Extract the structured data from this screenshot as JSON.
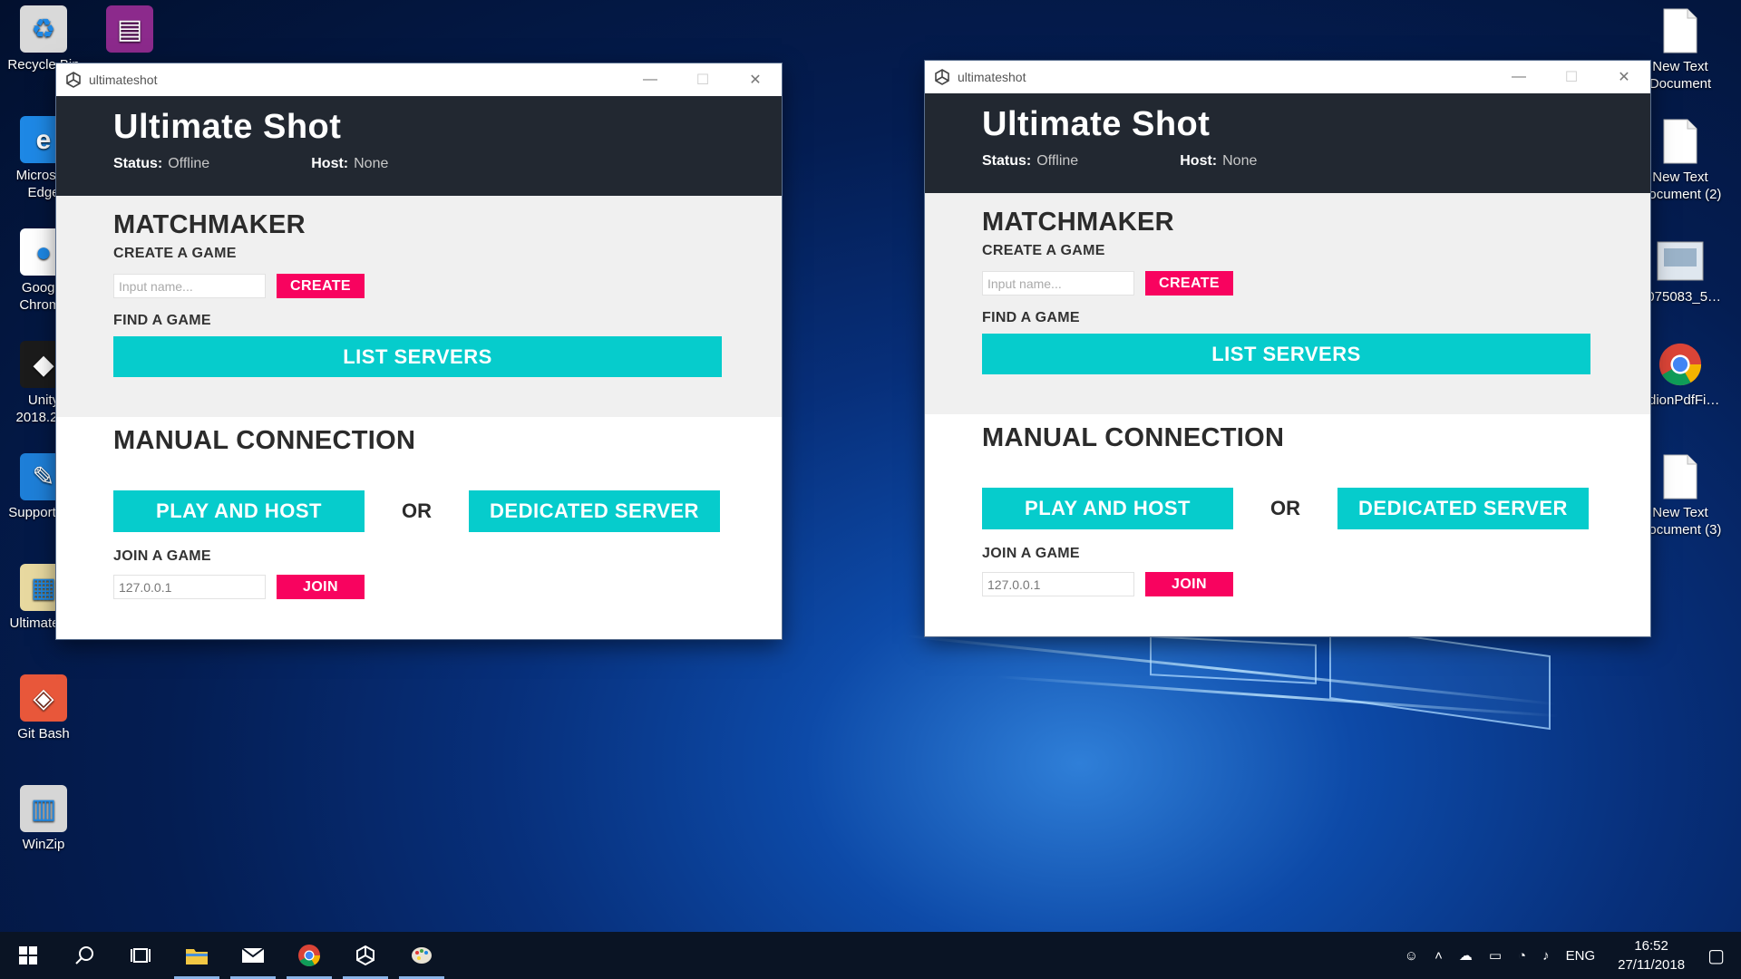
{
  "desktop": {
    "left_icons": [
      {
        "name": "recycle-bin-icon",
        "label": "Recycle Bin",
        "glyph": "♻",
        "bg": "#d9d9d9"
      },
      {
        "name": "winrar-icon",
        "label": "",
        "glyph": "▤",
        "bg": "#8c2a8c"
      },
      {
        "name": "edge-icon",
        "label": "Microsoft Edge",
        "glyph": "e",
        "bg": "#1e88e5"
      },
      {
        "name": "chrome-icon",
        "label": "Google Chrome",
        "glyph": "●",
        "bg": "#ffffff"
      },
      {
        "name": "unity-icon",
        "label": "Unity 2018.2…",
        "glyph": "◆",
        "bg": "#1b1b1b"
      },
      {
        "name": "support-icon",
        "label": "SupportA…",
        "glyph": "✎",
        "bg": "#1e7fd8"
      },
      {
        "name": "folder-icon",
        "label": "Ultimate-…",
        "glyph": "▦",
        "bg": "#e8d9a0"
      },
      {
        "name": "git-bash-icon",
        "label": "Git Bash",
        "glyph": "◈",
        "bg": "#e8573a"
      },
      {
        "name": "winzip-icon",
        "label": "WinZip",
        "glyph": "▥",
        "bg": "#d6d6d6"
      }
    ],
    "right_icons": [
      {
        "name": "text-document-icon",
        "label": "New Text Document"
      },
      {
        "name": "text-document-icon",
        "label": "New Text Document (2)"
      },
      {
        "name": "image-file-icon",
        "label": "5075083_5…"
      },
      {
        "name": "chrome-pdf-icon",
        "label": "edionPdfFi…"
      },
      {
        "name": "text-document-icon",
        "label": "New Text Document (3)"
      }
    ]
  },
  "windows": [
    {
      "title": "ultimateshot",
      "app_title": "Ultimate Shot",
      "status_label": "Status:",
      "status_value": "Offline",
      "host_label": "Host:",
      "host_value": "None",
      "matchmaker_heading": "MATCHMAKER",
      "create_heading": "CREATE A GAME",
      "name_placeholder": "Input name...",
      "create_button": "CREATE",
      "find_heading": "FIND A GAME",
      "list_button": "LIST SERVERS",
      "manual_heading": "MANUAL CONNECTION",
      "play_host_button": "PLAY AND HOST",
      "or_label": "OR",
      "dedicated_button": "DEDICATED SERVER",
      "join_heading": "JOIN A GAME",
      "ip_value": "127.0.0.1",
      "join_button": "JOIN"
    },
    {
      "title": "ultimateshot",
      "app_title": "Ultimate Shot",
      "status_label": "Status:",
      "status_value": "Offline",
      "host_label": "Host:",
      "host_value": "None",
      "matchmaker_heading": "MATCHMAKER",
      "create_heading": "CREATE A GAME",
      "name_placeholder": "Input name...",
      "create_button": "CREATE",
      "find_heading": "FIND A GAME",
      "list_button": "LIST SERVERS",
      "manual_heading": "MANUAL CONNECTION",
      "play_host_button": "PLAY AND HOST",
      "or_label": "OR",
      "dedicated_button": "DEDICATED SERVER",
      "join_heading": "JOIN A GAME",
      "ip_value": "127.0.0.1",
      "join_button": "JOIN"
    }
  ],
  "taskbar": {
    "language": "ENG",
    "time": "16:52",
    "date": "27/11/2018"
  },
  "colors": {
    "accent_pink": "#f8035f",
    "accent_cyan": "#06cccc",
    "header_dark": "#222831"
  }
}
